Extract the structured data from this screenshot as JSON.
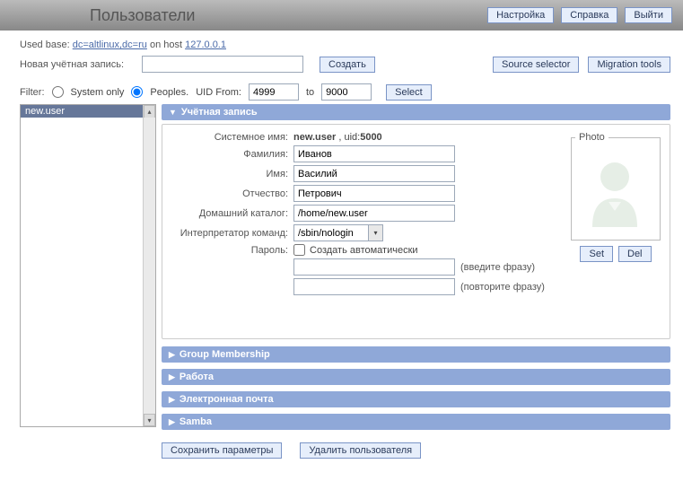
{
  "header": {
    "title": "Пользователи",
    "buttons": {
      "settings": "Настройка",
      "help": "Справка",
      "exit": "Выйти"
    }
  },
  "info": {
    "used_base_label": "Used base:",
    "used_base": "dc=altlinux,dc=ru",
    "on_host_label": "on host",
    "host": "127.0.0.1"
  },
  "new_account": {
    "label": "Новая учётная запись:",
    "value": "",
    "create_btn": "Создать",
    "source_selector": "Source selector",
    "migration_tools": "Migration tools"
  },
  "filter": {
    "label": "Filter:",
    "system_only": "System only",
    "peoples": "Peoples.",
    "uid_from_label": "UID From:",
    "uid_from": "4999",
    "to_label": "to",
    "uid_to": "9000",
    "select_btn": "Select"
  },
  "user_list": [
    "new.user"
  ],
  "account": {
    "section_title": "Учётная запись",
    "sysname_label": "Системное имя:",
    "sysname": "new.user",
    "uid_label": "uid:",
    "uid": "5000",
    "surname_label": "Фамилия:",
    "surname": "Иванов",
    "name_label": "Имя:",
    "name": "Василий",
    "patronymic_label": "Отчество:",
    "patronymic": "Петрович",
    "home_label": "Домашний каталог:",
    "home": "/home/new.user",
    "shell_label": "Интерпретатор команд:",
    "shell": "/sbin/nologin",
    "password_label": "Пароль:",
    "auto_create": "Создать автоматически",
    "hint_enter": "(введите фразу)",
    "hint_repeat": "(повторите фразу)",
    "photo_label": "Photo",
    "set_btn": "Set",
    "del_btn": "Del"
  },
  "sections": {
    "group": "Group Membership",
    "work": "Работа",
    "email": "Электронная почта",
    "samba": "Samba"
  },
  "actions": {
    "save": "Сохранить параметры",
    "delete": "Удалить пользователя"
  }
}
